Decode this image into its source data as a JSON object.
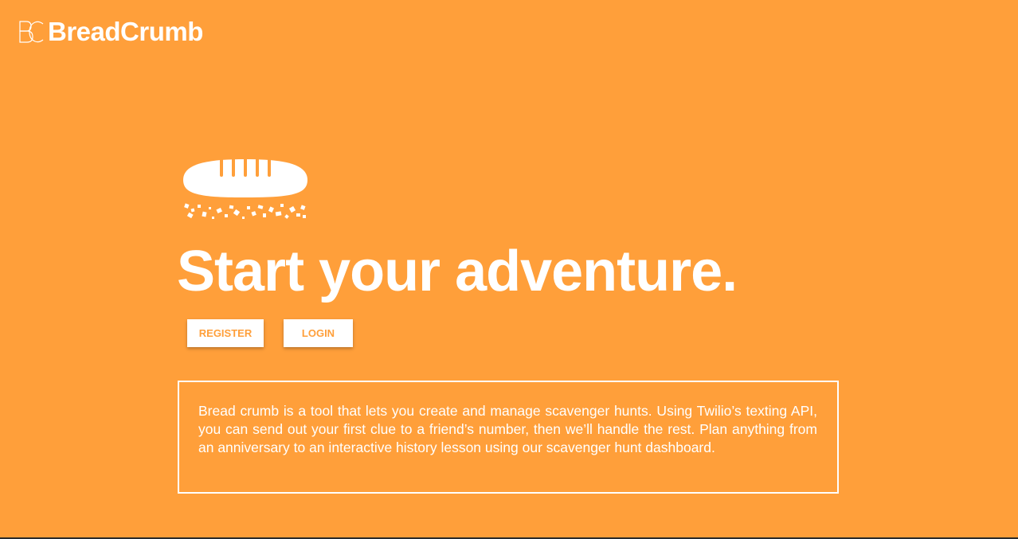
{
  "header": {
    "brand_name": "BreadCrumb",
    "logo_icon": "bc-monogram-logo"
  },
  "hero": {
    "illustration_icon": "bread-loaf-with-crumbs-icon",
    "title": "Start your adventure."
  },
  "actions": {
    "register_label": "REGISTER",
    "login_label": "LOGIN"
  },
  "description": {
    "text": "Bread crumb is a tool that lets you create and manage scavenger hunts. Using Twilio’s texting API, you can send out your first clue to a friend’s number, then we’ll handle the rest. Plan anything from an anniversary to an interactive history lesson using our scavenger hunt dashboard."
  },
  "colors": {
    "background": "#ff9f3a",
    "text": "#ffffff",
    "button_background": "#ffffff",
    "button_text": "#ff9f3a"
  }
}
